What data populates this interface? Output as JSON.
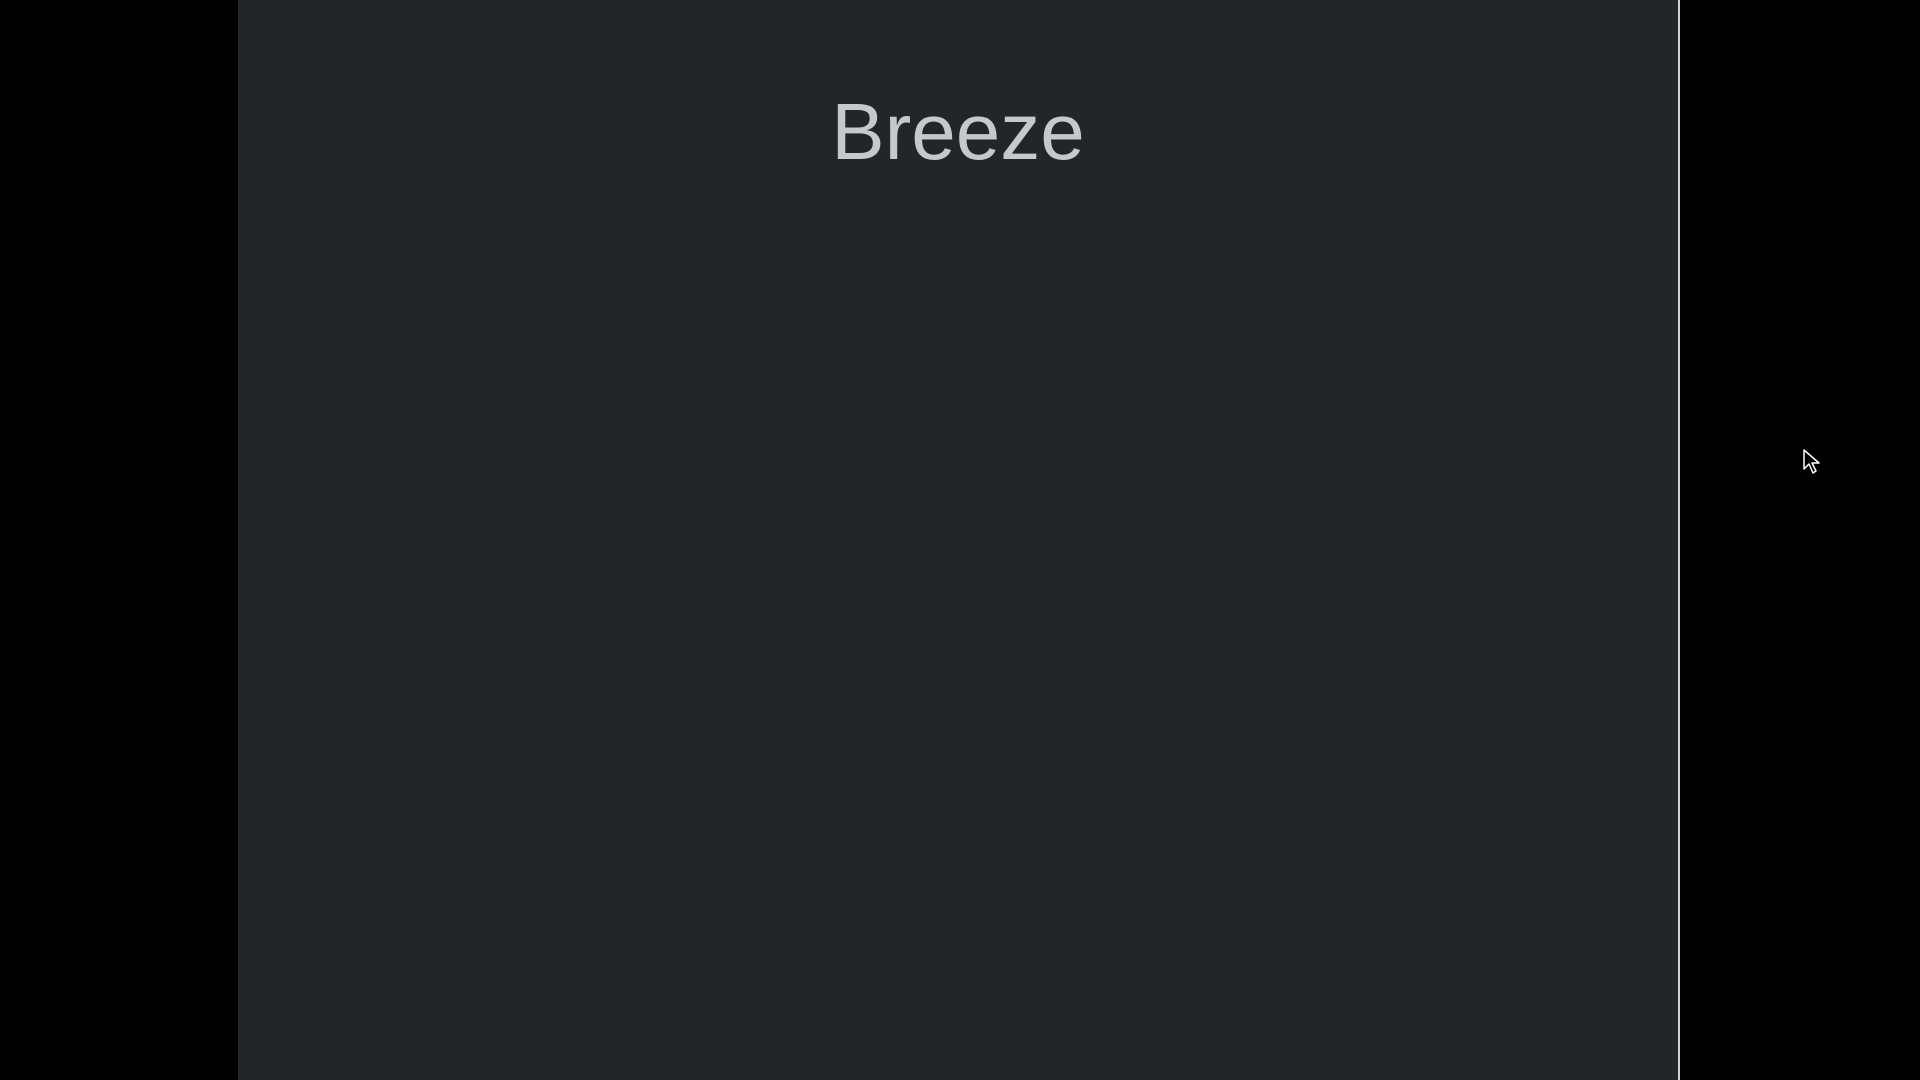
{
  "theme_preview": {
    "title": "Breeze"
  },
  "colors": {
    "background": "#000000",
    "panel": "#232629",
    "panel_border": "#cfd2d6",
    "title_text": "#c5c8cc"
  },
  "icons": {
    "cursor": "mouse-pointer-icon"
  }
}
